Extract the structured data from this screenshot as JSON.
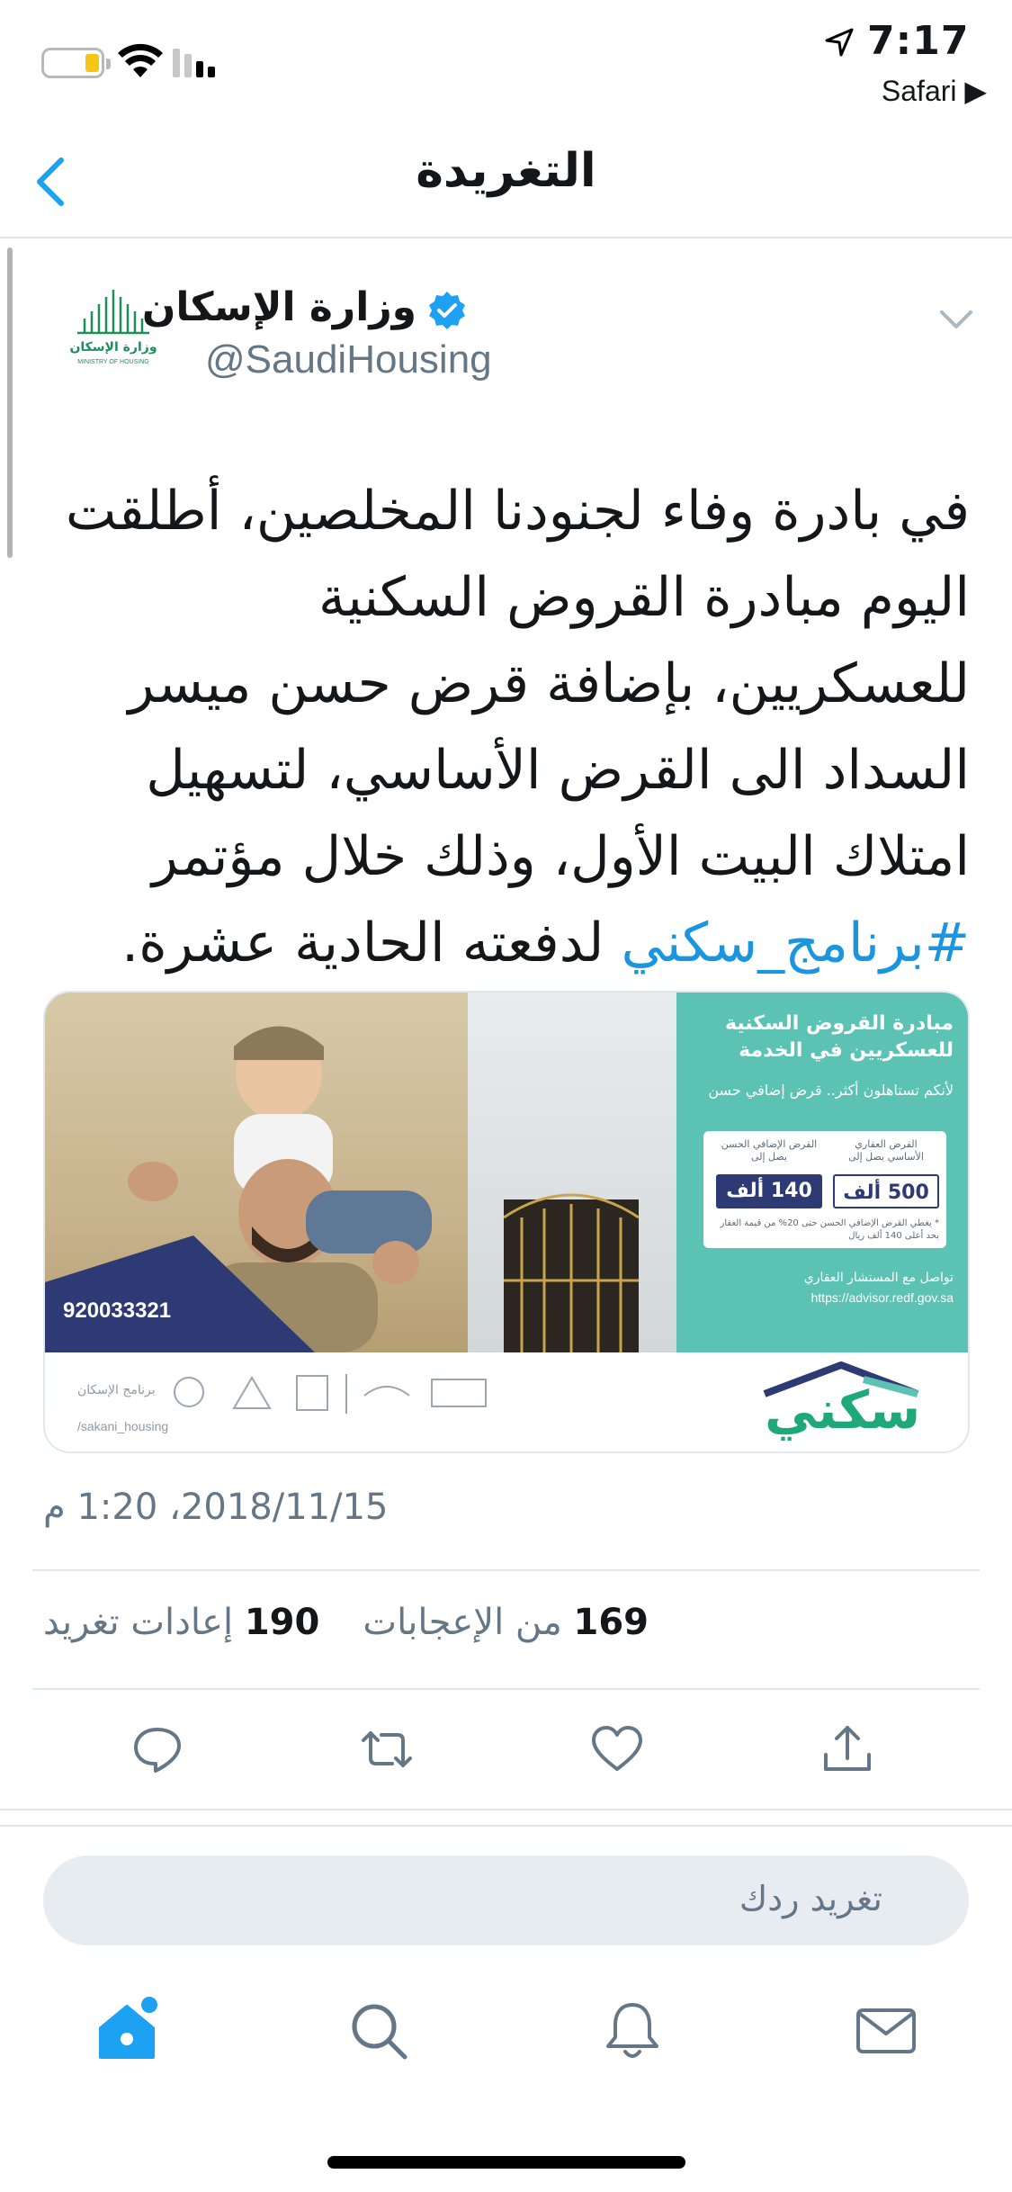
{
  "status_bar": {
    "time": "7:17",
    "back_app": "Safari ▶",
    "battery_color": "#f5c518"
  },
  "nav": {
    "title": "التغريدة",
    "back_icon": "chevron-left-icon"
  },
  "tweet": {
    "author_name": "وزارة الإسكان",
    "handle": "@SaudiHousing",
    "verified": true,
    "avatar_label": "وزارة الإسكان",
    "avatar_sublabel": "MINISTRY OF HOUSING",
    "text_before": "في بادرة وفاء لجنودنا المخلصين، أطلقت اليوم مبادرة القروض السكنية للعسكريين، بإضافة قرض حسن ميسر السداد الى القرض الأساسي، لتسهيل امتلاك البيت الأول، وذلك خلال مؤتمر ",
    "hashtag": "#برنامج_سكني",
    "text_after": " لدفعته الحادية عشرة.",
    "timestamp": "2018/11/15، 1:20 م",
    "likes_count": "169",
    "likes_label": "من الإعجابات",
    "retweets_count": "190",
    "retweets_label": "إعادات تغريد"
  },
  "media": {
    "panel_title": "مبادرة القروض السكنية للعسكريين في الخدمة",
    "panel_sub": "لأنكم تستاهلون أكثر.. قرض إضافي حسن",
    "col_a_label": "القرض العقاري الأساسي يصل إلى",
    "col_b_label": "القرض الإضافي الحسن يصل إلى",
    "value_a": "500 ألف",
    "value_b": "140 ألف",
    "note": "* يغطي القرض الإضافي الحسن حتى 20% من قيمة العقار بحد أعلى 140 ألف ريال",
    "contact": "تواصل مع المستشار العقاري",
    "contact_url": "https://advisor.redf.gov.sa",
    "phone": "920033321",
    "brand": "سكني",
    "program_label": "برنامج الإسكان",
    "social_handle": "/sakani_housing",
    "panel_color": "#5cc3b4",
    "brand_color": "#1fa87a",
    "navy_color": "#2d3a73"
  },
  "actions": {
    "reply_icon": "reply-icon",
    "retweet_icon": "retweet-icon",
    "like_icon": "heart-icon",
    "share_icon": "share-icon"
  },
  "reply": {
    "placeholder": "تغريد ردك"
  },
  "tabs": {
    "home": "home-icon",
    "search": "search-icon",
    "notifications": "bell-icon",
    "messages": "mail-icon",
    "accent": "#1da1f2"
  }
}
